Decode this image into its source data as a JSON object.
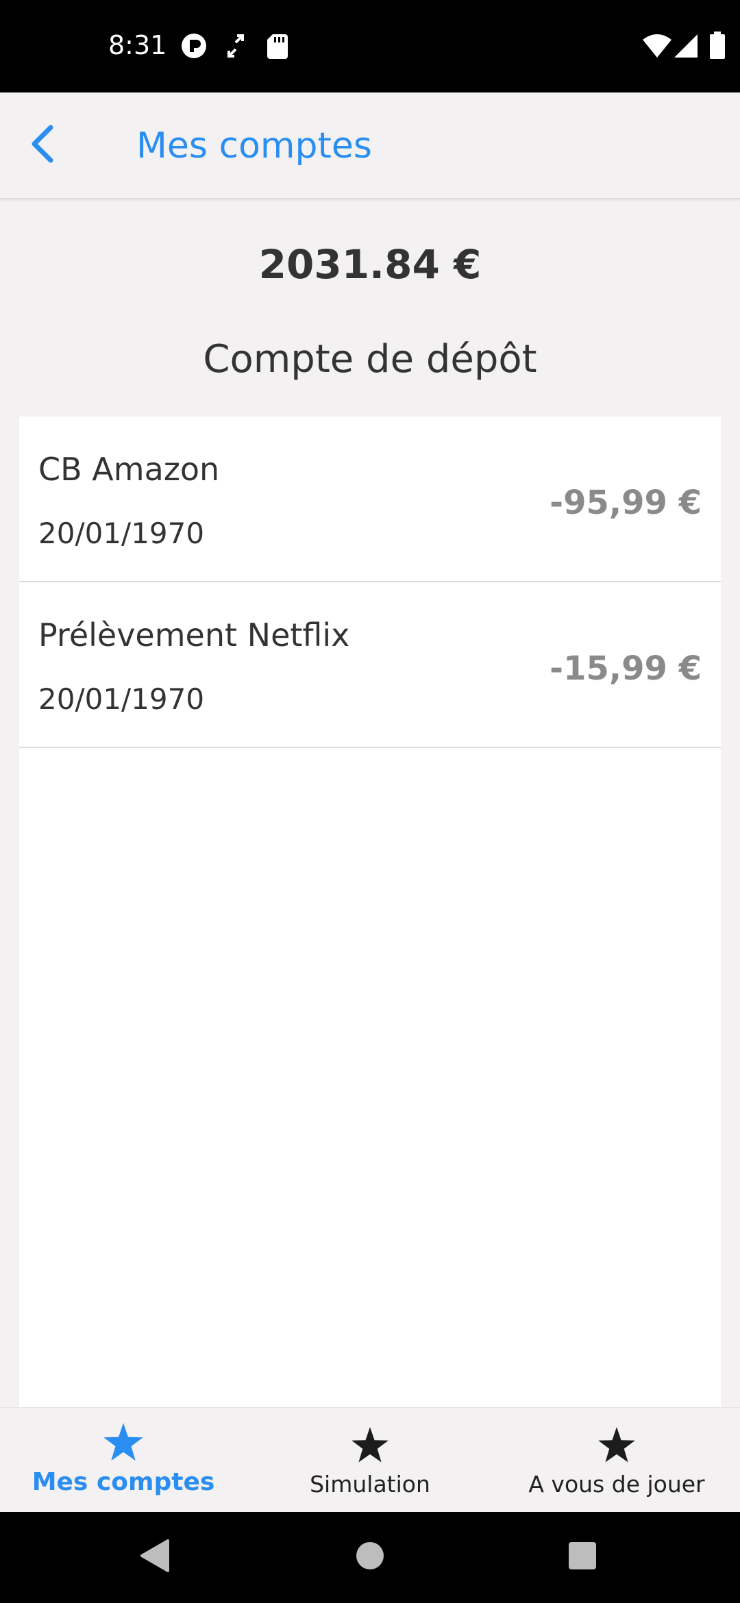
{
  "status_bar": {
    "time": "8:31",
    "icons_left": [
      "app-notification-icon",
      "transfer-icon",
      "sd-card-icon"
    ],
    "icons_right": [
      "wifi-icon",
      "signal-icon",
      "battery-icon"
    ]
  },
  "header": {
    "title": "Mes comptes",
    "back_icon": "chevron-left-icon"
  },
  "balance": "2031.84 €",
  "section_title": "Compte de dépôt",
  "transactions": [
    {
      "name": "CB Amazon",
      "date": "20/01/1970",
      "amount": "-95,99 €"
    },
    {
      "name": "Prélèvement Netflix",
      "date": "20/01/1970",
      "amount": "-15,99 €"
    }
  ],
  "tabs": [
    {
      "label": "Mes comptes",
      "icon": "star-icon",
      "active": true
    },
    {
      "label": "Simulation",
      "icon": "star-icon",
      "active": false
    },
    {
      "label": "A vous de jouer",
      "icon": "star-icon",
      "active": false
    }
  ],
  "colors": {
    "accent": "#2a8ef0",
    "background": "#f3f1f2",
    "amount": "#8a8a8a",
    "text": "#333333"
  }
}
